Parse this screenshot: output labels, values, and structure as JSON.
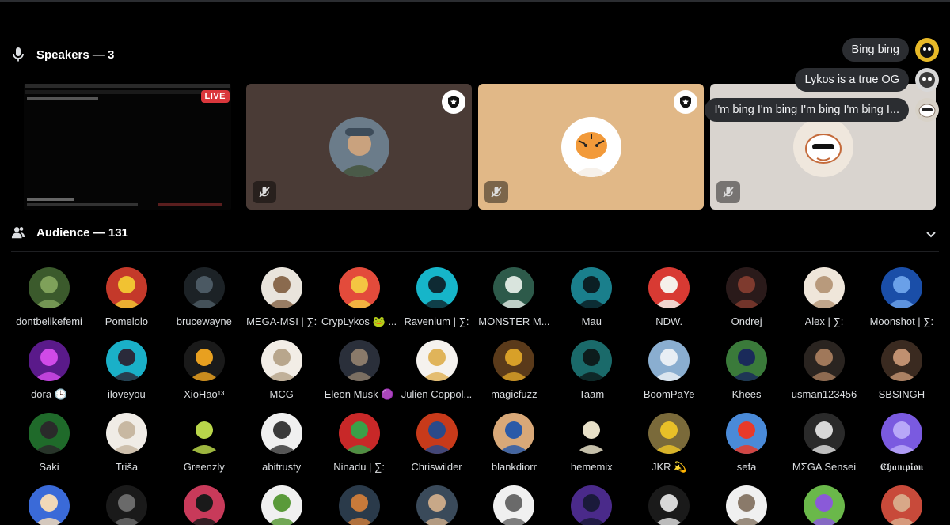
{
  "speakers": {
    "title": "Speakers — 3",
    "live_label": "LIVE",
    "tiles": [
      {
        "bg": "#4a3b36",
        "avatar": "#6b7c8a",
        "accent": "#c9a27e",
        "has_badge": true
      },
      {
        "bg": "#e1b887",
        "avatar": "#ffffff",
        "accent": "#f29a3a",
        "has_badge": true
      },
      {
        "bg": "#d9d4cf",
        "avatar": "#efe7dd",
        "accent": "#e7a85a",
        "has_badge": true
      }
    ]
  },
  "chat": {
    "messages": [
      {
        "text": "Bing bing",
        "avatar": "#e7b928"
      },
      {
        "text": "Lykos is a true OG",
        "avatar": "#3a3a3a"
      },
      {
        "text": "I'm bing I'm bing I'm bing I'm bing I...",
        "avatar": "#d8d2c8"
      }
    ]
  },
  "audience": {
    "title": "Audience — 131",
    "members": [
      {
        "name": "dontbelikefemi",
        "c1": "#3b5a2c",
        "c2": "#7fa15a"
      },
      {
        "name": "Pomelolo",
        "c1": "#c4392a",
        "c2": "#f1c232"
      },
      {
        "name": "brucewayne",
        "c1": "#1c2226",
        "c2": "#4b5963"
      },
      {
        "name": "MEGA-MSI | ∑:",
        "c1": "#e9e4dc",
        "c2": "#8a6a4e"
      },
      {
        "name": "CrypLykos 🐸 ...",
        "c1": "#e34b3b",
        "c2": "#f4c542"
      },
      {
        "name": "Ravenium | ∑:",
        "c1": "#16b5c9",
        "c2": "#0e2a33"
      },
      {
        "name": "MONSTER M...",
        "c1": "#2d5a4a",
        "c2": "#d9e4dd"
      },
      {
        "name": "Mau",
        "c1": "#1a7f8c",
        "c2": "#0b1f24"
      },
      {
        "name": "NDW.",
        "c1": "#d83a33",
        "c2": "#f5f0ea"
      },
      {
        "name": "Ondrej",
        "c1": "#2a1a1a",
        "c2": "#7e3a2e"
      },
      {
        "name": "Alex | ∑:",
        "c1": "#efe6da",
        "c2": "#b89a7c"
      },
      {
        "name": "Moonshot | ∑:",
        "c1": "#1a4ea8",
        "c2": "#6aa0e8"
      },
      {
        "name": "dora 🕒",
        "c1": "#5a1a8a",
        "c2": "#d04ae8"
      },
      {
        "name": "iloveyou",
        "c1": "#1ab0c8",
        "c2": "#2a2a3a"
      },
      {
        "name": "XioHao¹³",
        "c1": "#1a1a1a",
        "c2": "#e8a020"
      },
      {
        "name": "MCG",
        "c1": "#f2ede6",
        "c2": "#b8a68c"
      },
      {
        "name": "Eleon Musk 🟣",
        "c1": "#2a2f3a",
        "c2": "#8a7a6a"
      },
      {
        "name": "Julien Coppol...",
        "c1": "#f5f2ee",
        "c2": "#e0b45a"
      },
      {
        "name": "magicfuzz",
        "c1": "#5a3a1a",
        "c2": "#d8a028"
      },
      {
        "name": "Taam",
        "c1": "#1a6a6a",
        "c2": "#0d1c1c"
      },
      {
        "name": "BoomPaYe",
        "c1": "#8aaed0",
        "c2": "#e8eef4"
      },
      {
        "name": "Khees",
        "c1": "#3a7a3a",
        "c2": "#1a2a5a"
      },
      {
        "name": "usman123456",
        "c1": "#2a2420",
        "c2": "#a0785a"
      },
      {
        "name": "SBSINGH",
        "c1": "#3a2a20",
        "c2": "#c09070"
      },
      {
        "name": "Saki",
        "c1": "#1f6a2a",
        "c2": "#2a2a2a"
      },
      {
        "name": "Triša",
        "c1": "#f0ece6",
        "c2": "#c8b8a2"
      },
      {
        "name": "Greenzly",
        "c1": "#000000",
        "c2": "#b9d64a"
      },
      {
        "name": "abitrusty",
        "c1": "#f0f0f0",
        "c2": "#3a3a3a"
      },
      {
        "name": "Ninadu | ∑:",
        "c1": "#c82828",
        "c2": "#3aa048"
      },
      {
        "name": "Chriswilder",
        "c1": "#c83a1a",
        "c2": "#2a4a8a"
      },
      {
        "name": "blankdiorr",
        "c1": "#d8a878",
        "c2": "#2a5aa8"
      },
      {
        "name": "hememix",
        "c1": "#000000",
        "c2": "#e8e0c8"
      },
      {
        "name": "JKR 💫",
        "c1": "#7a6a3a",
        "c2": "#e8c028"
      },
      {
        "name": "sefa",
        "c1": "#4a8ad8",
        "c2": "#e83a2a"
      },
      {
        "name": "MΣGA Sensei",
        "c1": "#2a2a2a",
        "c2": "#d8d8d8"
      },
      {
        "name": "𝕮𝖍𝖆𝖒𝖕𝖎𝖔𝖓",
        "c1": "#7a5ae0",
        "c2": "#b8a8f8"
      },
      {
        "name": "",
        "c1": "#3a6ad8",
        "c2": "#f0d8b8"
      },
      {
        "name": "",
        "c1": "#1a1a1a",
        "c2": "#6a6a6a"
      },
      {
        "name": "",
        "c1": "#c83a5a",
        "c2": "#1a1a1a"
      },
      {
        "name": "",
        "c1": "#f0f0f0",
        "c2": "#5a9a3a"
      },
      {
        "name": "",
        "c1": "#2a3a4a",
        "c2": "#c87a3a"
      },
      {
        "name": "",
        "c1": "#3a4a5a",
        "c2": "#c8a888"
      },
      {
        "name": "",
        "c1": "#f0f0f0",
        "c2": "#6a6a6a"
      },
      {
        "name": "",
        "c1": "#4a2a8a",
        "c2": "#1a1a3a"
      },
      {
        "name": "",
        "c1": "#1a1a1a",
        "c2": "#d8d8d8"
      },
      {
        "name": "",
        "c1": "#f0f0f0",
        "c2": "#8a7a6a"
      },
      {
        "name": "",
        "c1": "#6ab84a",
        "c2": "#8a5ad8"
      },
      {
        "name": "",
        "c1": "#c84a3a",
        "c2": "#d8a888"
      }
    ]
  },
  "icons": {
    "mic": "microphone-icon",
    "people": "people-icon",
    "chevron": "chevron-down-icon",
    "muted": "microphone-muted-icon",
    "moderator": "moderator-badge-icon"
  }
}
